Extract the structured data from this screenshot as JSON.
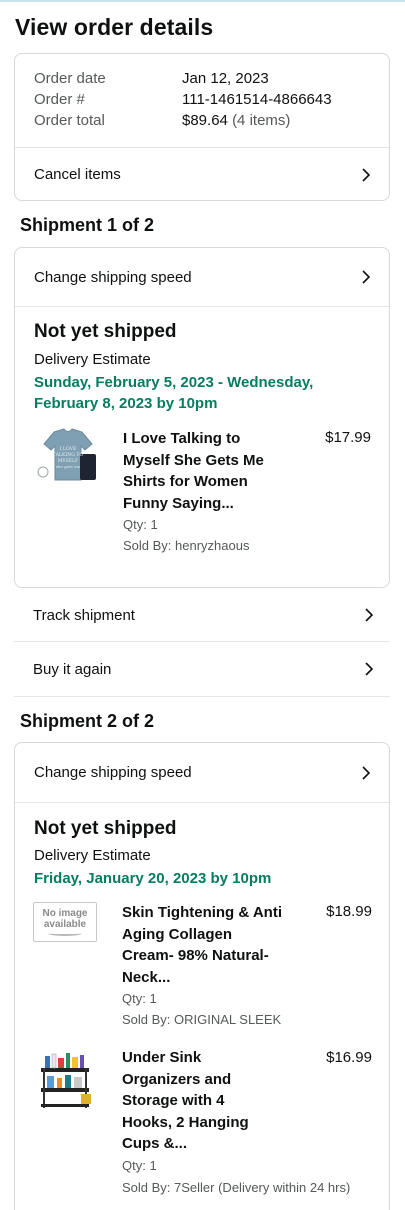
{
  "page": {
    "title": "View order details"
  },
  "order": {
    "date_label": "Order date",
    "date_value": "Jan 12, 2023",
    "number_label": "Order #",
    "number_value": "111-1461514-4866643",
    "total_label": "Order total",
    "total_value": "$89.64",
    "total_items": "(4 items)",
    "cancel_label": "Cancel items"
  },
  "shipments": [
    {
      "title": "Shipment 1 of 2",
      "change_speed": "Change shipping speed",
      "status": "Not yet shipped",
      "estimate_label": "Delivery Estimate",
      "estimate_dates": "Sunday, February 5, 2023 - Wednesday, February 8, 2023 by 10pm",
      "items": [
        {
          "title": "I Love Talking to Myself She Gets Me Shirts for Women Funny Saying...",
          "price": "$17.99",
          "qty": "Qty: 1",
          "seller": "Sold By: henryzhaous",
          "shirt_text": "I LOVE TALKING TO MYSELF she gets me",
          "icon": "tshirt-icon"
        }
      ],
      "track_label": "Track shipment",
      "buy_again_label": "Buy it again"
    },
    {
      "title": "Shipment 2 of 2",
      "change_speed": "Change shipping speed",
      "status": "Not yet shipped",
      "estimate_label": "Delivery Estimate",
      "estimate_dates": "Friday, January 20, 2023 by 10pm",
      "items": [
        {
          "title": "Skin Tightening & Anti Aging Collagen Cream- 98% Natural-Neck...",
          "price": "$18.99",
          "qty": "Qty: 1",
          "seller": "Sold By: ORIGINAL SLEEK",
          "noimg_line1": "No image",
          "noimg_line2": "available"
        },
        {
          "title": "Under Sink Organizers and Storage with 4 Hooks, 2 Hanging Cups &...",
          "price": "$16.99",
          "qty": "Qty: 1",
          "seller": "Sold By: 7Seller (Delivery within 24 hrs)",
          "icon": "organizer-icon"
        }
      ]
    }
  ],
  "colors": {
    "accent_green": "#067d62",
    "border": "#d5d9d9",
    "muted": "#565959"
  }
}
